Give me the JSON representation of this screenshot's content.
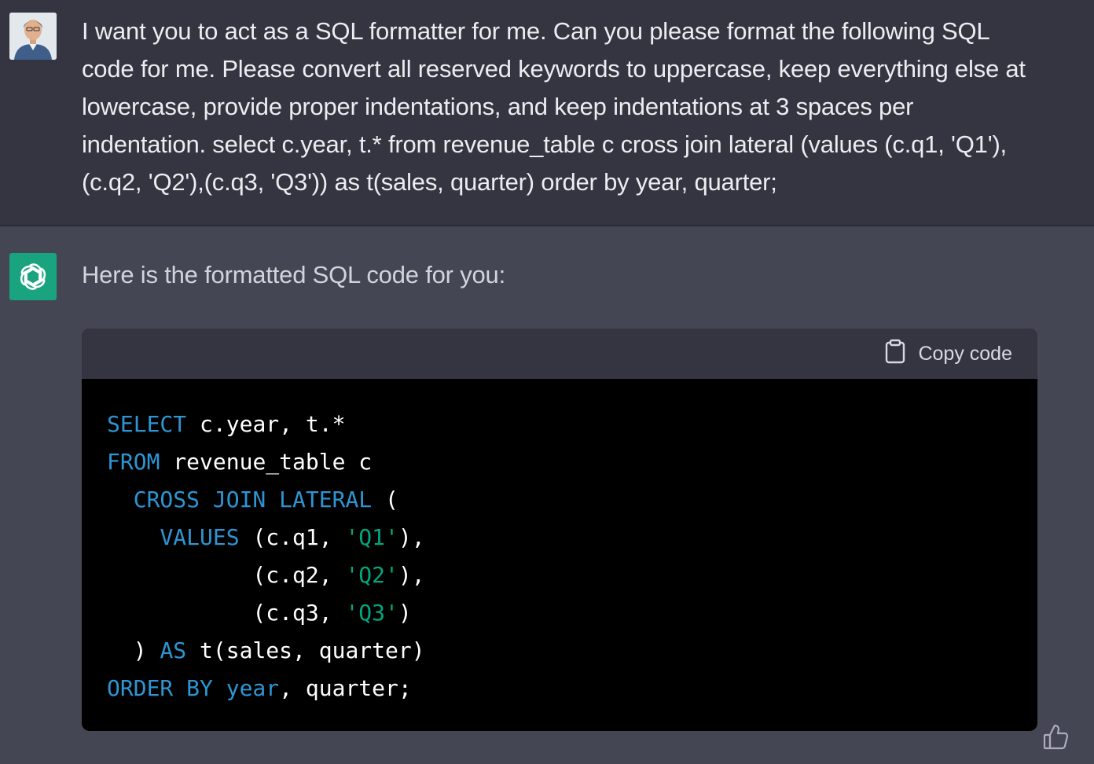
{
  "conversation": {
    "user_message": "I want you to act as a SQL formatter for me. Can you please format the following SQL\ncode for me. Please convert all reserved keywords to uppercase, keep everything else at\nlowercase, provide proper indentations, and keep indentations at 3 spaces per\nindentation. select c.year, t.* from revenue_table c cross join lateral (values (c.q1, 'Q1'),\n(c.q2, 'Q2'),(c.q3, 'Q3')) as t(sales, quarter) order by year, quarter;",
    "assistant_intro": "Here is the formatted SQL code for you:"
  },
  "code_block": {
    "copy_label": "Copy code",
    "lines": [
      [
        {
          "t": "SELECT",
          "k": "kw"
        },
        {
          "t": " c.year, t.*"
        }
      ],
      [
        {
          "t": "FROM",
          "k": "kw"
        },
        {
          "t": " revenue_table c"
        }
      ],
      [
        {
          "t": "  "
        },
        {
          "t": "CROSS JOIN LATERAL",
          "k": "kw"
        },
        {
          "t": " ("
        }
      ],
      [
        {
          "t": "    "
        },
        {
          "t": "VALUES",
          "k": "kw"
        },
        {
          "t": " (c.q1, "
        },
        {
          "t": "'Q1'",
          "k": "str"
        },
        {
          "t": "),"
        }
      ],
      [
        {
          "t": "           (c.q2, "
        },
        {
          "t": "'Q2'",
          "k": "str"
        },
        {
          "t": "),"
        }
      ],
      [
        {
          "t": "           (c.q3, "
        },
        {
          "t": "'Q3'",
          "k": "str"
        },
        {
          "t": ")"
        }
      ],
      [
        {
          "t": "  ) "
        },
        {
          "t": "AS",
          "k": "kw"
        },
        {
          "t": " t(sales, quarter)"
        }
      ],
      [
        {
          "t": "ORDER BY",
          "k": "kw"
        },
        {
          "t": " "
        },
        {
          "t": "year",
          "k": "kw"
        },
        {
          "t": ", quarter;"
        }
      ]
    ]
  },
  "icons": {
    "copy": "clipboard-icon",
    "feedback": "thumbs-up-icon",
    "assistant_logo": "openai-logo-icon"
  },
  "colors": {
    "user_bg": "#343541",
    "assistant_bg": "#444654",
    "code_bg": "#000000",
    "keyword": "#2e95d3",
    "string": "#00a67d",
    "brand_green": "#19a37f"
  }
}
